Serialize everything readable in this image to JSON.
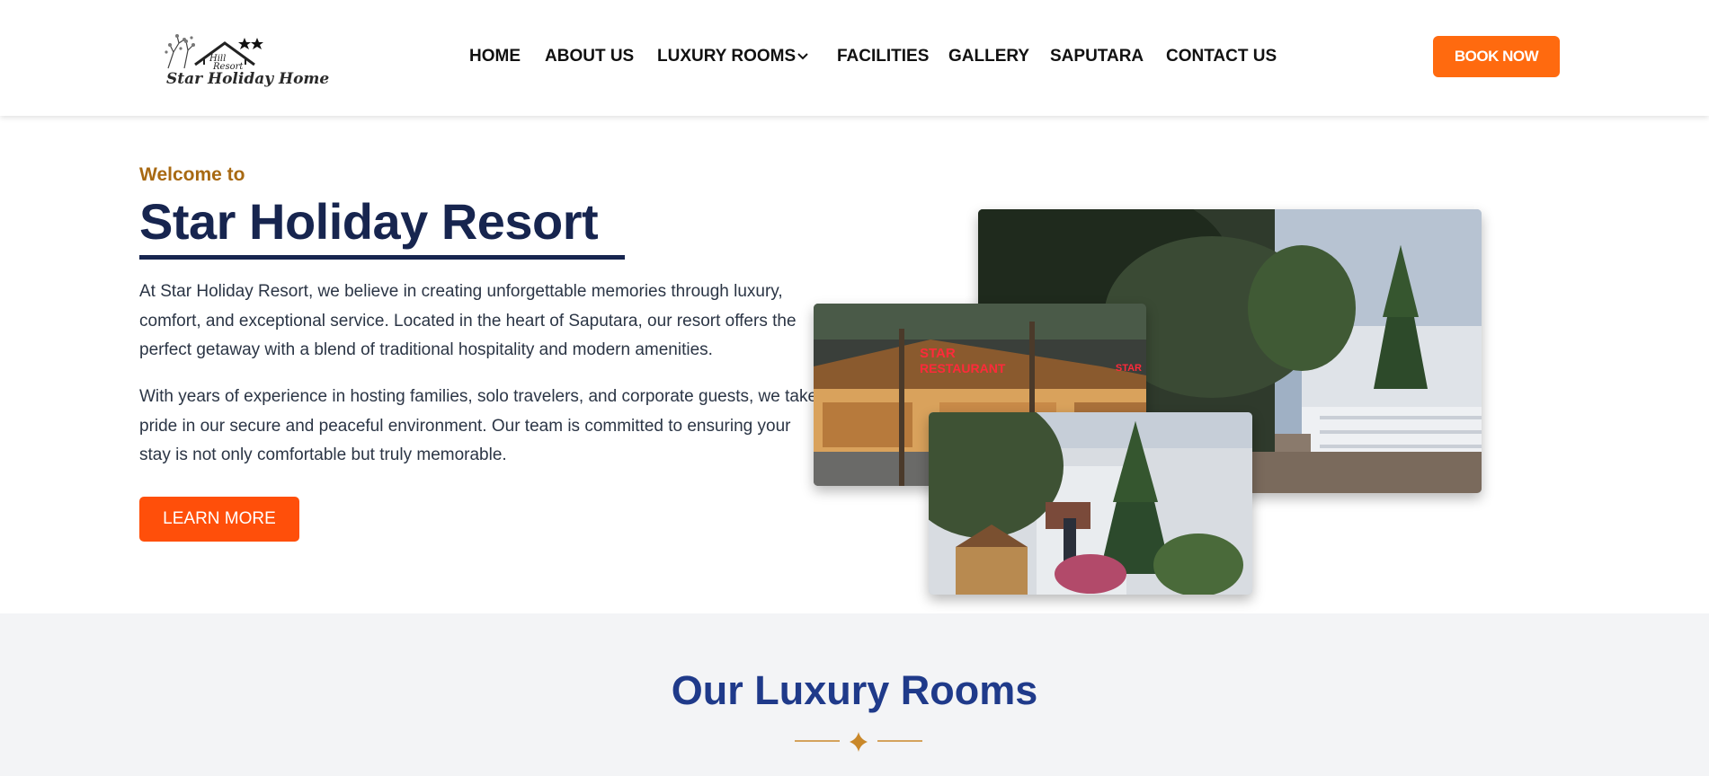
{
  "header": {
    "logo": {
      "small_text_1": "Hill",
      "small_text_2": "Resort",
      "name": "Star Holiday Home"
    },
    "nav": [
      {
        "label": "HOME"
      },
      {
        "label": "ABOUT US"
      },
      {
        "label": "LUXURY ROOMS",
        "has_dropdown": true,
        "icon": "chevron-down-icon"
      },
      {
        "label": "FACILITIES"
      },
      {
        "label": "GALLERY"
      },
      {
        "label": "SAPUTARA"
      },
      {
        "label": "CONTACT US"
      }
    ],
    "book_button": "BOOK NOW"
  },
  "hero": {
    "eyebrow": "Welcome to",
    "title": "Star Holiday Resort",
    "paragraph_1": "At Star Holiday Resort, we believe in creating unforgettable memories through luxury, comfort, and exceptional service. Located in the heart of Saputara, our resort offers the perfect getaway with a blend of traditional hospitality and modern amenities.",
    "paragraph_2": "With years of experience in hosting families, solo travelers, and corporate guests, we take pride in our secure and peaceful environment. Our team is committed to ensuring your stay is not only comfortable but truly memorable.",
    "cta_button": "LEARN MORE",
    "photos": {
      "restaurant_sign": "STAR RESTAURANT",
      "sign_line_1": "STAR",
      "sign_line_2": "RESTAURANT"
    }
  },
  "rooms_section": {
    "title": "Our Luxury Rooms"
  },
  "colors": {
    "brand_orange": "#ff6a0f",
    "cta_orange": "#ff4f0a",
    "navy": "#17254f",
    "gold": "#a86912",
    "section_blue": "#1f3a8a"
  }
}
